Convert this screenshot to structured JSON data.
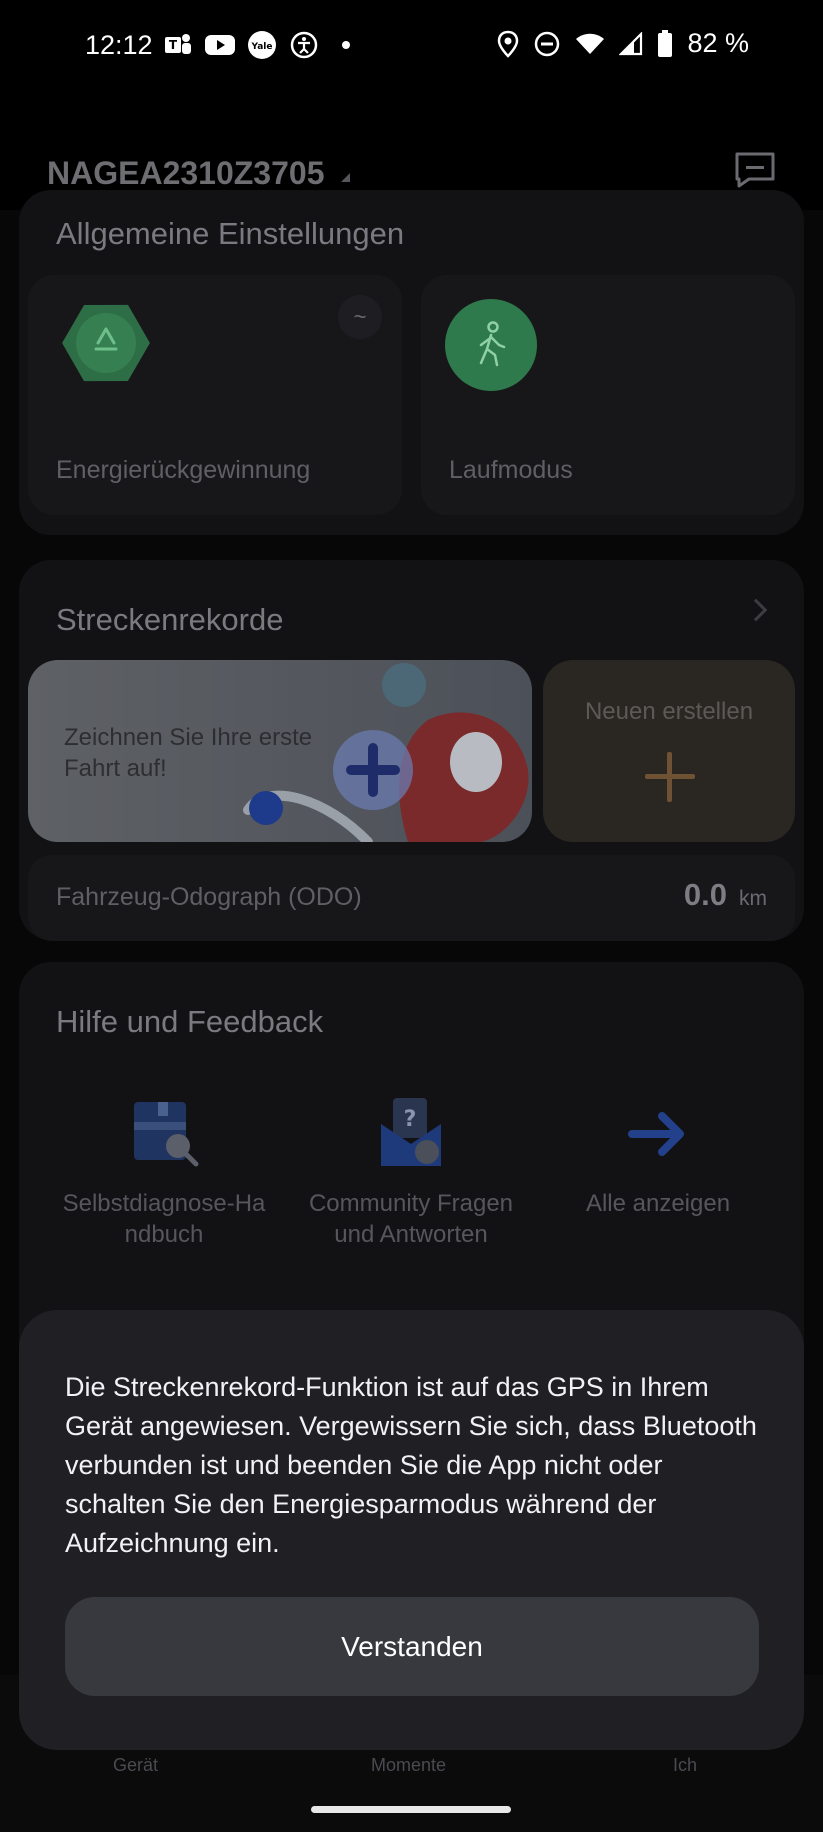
{
  "status_bar": {
    "time": "12:12",
    "battery_text": "82 %",
    "left_icons": [
      "teams-icon",
      "youtube-icon",
      "yale-icon",
      "accessibility-icon",
      "dot-icon"
    ],
    "right_icons": [
      "location-icon",
      "dnd-icon",
      "wifi-icon",
      "signal-icon",
      "battery-icon"
    ]
  },
  "header": {
    "device_name": "NAGEA2310Z3705"
  },
  "general_settings": {
    "title": "Allgemeine Einstellungen",
    "tiles": [
      {
        "label": "Energierückgewinnung",
        "badge": "~"
      },
      {
        "label": "Laufmodus"
      }
    ]
  },
  "track_records": {
    "title": "Streckenrekorde",
    "banner_text": "Zeichnen Sie Ihre erste Fahrt auf!",
    "new_label": "Neuen erstellen",
    "odo_label": "Fahrzeug-Odograph (ODO)",
    "odo_value": "0.0",
    "odo_unit": "km"
  },
  "help": {
    "title": "Hilfe und Feedback",
    "items": [
      {
        "label": "Selbstdiagnose-Ha ndbuch"
      },
      {
        "label": "Community Fragen und Antworten"
      },
      {
        "label": "Alle anzeigen"
      }
    ]
  },
  "bottom_nav": {
    "items": [
      "Gerät",
      "Momente",
      "Ich"
    ]
  },
  "dialog": {
    "text": "Die Streckenrekord-Funktion ist auf das GPS in Ihrem Gerät angewiesen. Vergewissern Sie sich, dass Bluetooth verbunden ist und beenden Sie die App nicht oder schalten Sie den Energiesparmodus während der Aufzeichnung ein.",
    "button": "Verstanden"
  },
  "colors": {
    "accent_green": "#2f7a4c",
    "dialog_bg": "#1f1f24",
    "dialog_button": "#38383f"
  }
}
